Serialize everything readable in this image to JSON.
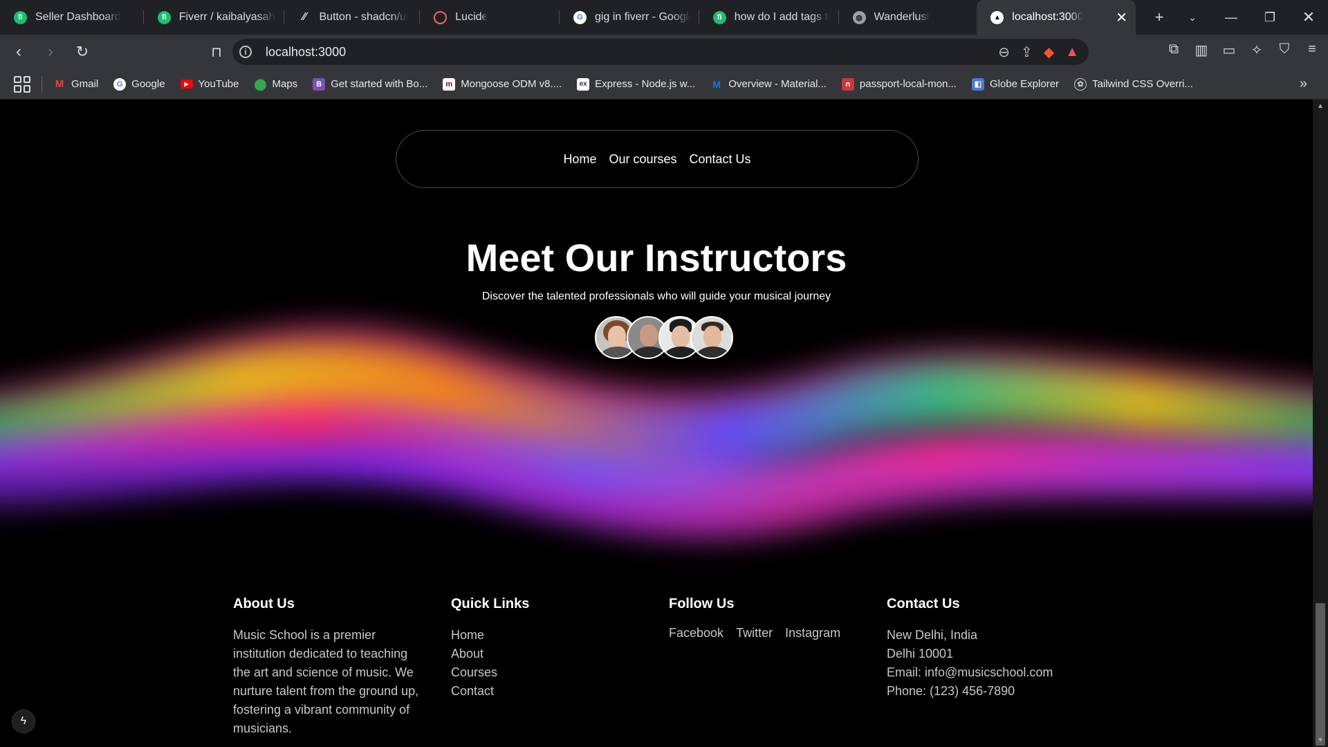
{
  "browser": {
    "tabs": [
      {
        "title": "Seller Dashboard",
        "icon": "fiverr-icon",
        "color": "#1dbf73"
      },
      {
        "title": "Fiverr / kaibalyasahoo",
        "icon": "fiverr-icon",
        "color": "#1dbf73"
      },
      {
        "title": "Button - shadcn/ui",
        "icon": "shadcn-icon",
        "color": "#202124"
      },
      {
        "title": "Lucide",
        "icon": "lucide-icon",
        "color": "#f56565"
      },
      {
        "title": "gig in fiverr - Google",
        "icon": "google-icon",
        "color": "#ffffff"
      },
      {
        "title": "how do I add tags to",
        "icon": "fiverr-icon",
        "color": "#1dbf73"
      },
      {
        "title": "Wanderlust",
        "icon": "globe-icon",
        "color": "#9aa0a6"
      },
      {
        "title": "localhost:3000",
        "icon": "vercel-icon",
        "color": "#ffffff",
        "active": true
      }
    ],
    "url": "localhost:3000",
    "bookmarks": [
      {
        "label": "Gmail",
        "icon": "gmail-icon",
        "color": "#ea4335"
      },
      {
        "label": "Google",
        "icon": "google-icon",
        "color": "#4285f4"
      },
      {
        "label": "YouTube",
        "icon": "youtube-icon",
        "color": "#ff0000"
      },
      {
        "label": "Maps",
        "icon": "maps-icon",
        "color": "#34a853"
      },
      {
        "label": "Get started with Bo...",
        "icon": "bootstrap-icon",
        "color": "#7952b3"
      },
      {
        "label": "Mongoose ODM v8....",
        "icon": "mongoose-icon",
        "color": "#880000"
      },
      {
        "label": "Express - Node.js w...",
        "icon": "express-icon",
        "color": "#333333"
      },
      {
        "label": "Overview - Material...",
        "icon": "mui-icon",
        "color": "#007fff"
      },
      {
        "label": "passport-local-mon...",
        "icon": "npm-icon",
        "color": "#cb3837"
      },
      {
        "label": "Globe Explorer",
        "icon": "globe-explorer-icon",
        "color": "#4a7bd0"
      },
      {
        "label": "Tailwind CSS Overri...",
        "icon": "openai-icon",
        "color": "#cccccc"
      }
    ]
  },
  "nav": {
    "home": "Home",
    "courses": "Our courses",
    "contact": "Contact Us"
  },
  "hero": {
    "title": "Meet Our Instructors",
    "subtitle": "Discover the talented professionals who will guide your musical journey"
  },
  "footer": {
    "about": {
      "heading": "About Us",
      "text": "Music School is a premier institution dedicated to teaching the art and science of music. We nurture talent from the ground up, fostering a vibrant community of musicians."
    },
    "quick_links": {
      "heading": "Quick Links",
      "items": [
        "Home",
        "About",
        "Courses",
        "Contact"
      ]
    },
    "follow": {
      "heading": "Follow Us",
      "items": [
        "Facebook",
        "Twitter",
        "Instagram"
      ]
    },
    "contact": {
      "heading": "Contact Us",
      "lines": [
        "New Delhi, India",
        "Delhi 10001",
        "Email: info@musicschool.com",
        "Phone: (123) 456-7890"
      ]
    }
  }
}
